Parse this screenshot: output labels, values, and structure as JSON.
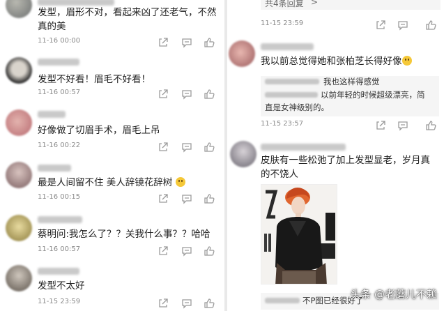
{
  "left": {
    "comments": [
      {
        "username": "",
        "text": "发型，眉形不对，看起来凶了还老气，不然真的美",
        "time": "11-16 00:00"
      },
      {
        "username": "",
        "text": "发型不好看！眉毛不好看！",
        "time": "11-16 00:57"
      },
      {
        "username": "",
        "text": "好像做了切眉手术，眉毛上吊",
        "time": "11-16 00:22"
      },
      {
        "username": "",
        "text": "最是人间留不住 美人辞镜花辞树",
        "time": "11-16 00:15"
      },
      {
        "username": "",
        "text": "蔡明问:我怎么了？？关我什么事？？哈哈",
        "time": "11-16 00:57"
      },
      {
        "username": "",
        "text": "发型不太好",
        "time": "11-15 23:59"
      }
    ]
  },
  "right": {
    "top_replies_label": "共4条回复",
    "top_time": "11-15 23:59",
    "comment1": {
      "text": "我以前总觉得她和张柏芝长得好像",
      "quote_line1": "我也这样得感觉",
      "quote_line2": "以前年轻的时候超级漂亮，简",
      "quote_line3": "直是女神级别的。",
      "time": "11-15 23:57"
    },
    "comment2": {
      "text": "皮肤有一些松弛了加上发型显老，岁月真的不饶人",
      "bottom_text": "不P图已经很好了"
    },
    "watermark": "头条 @老蘑儿不赖"
  },
  "colors": {
    "icon": "#9a9a9a",
    "time": "#8a8a8a",
    "quote_bg": "#f5f5f5"
  }
}
